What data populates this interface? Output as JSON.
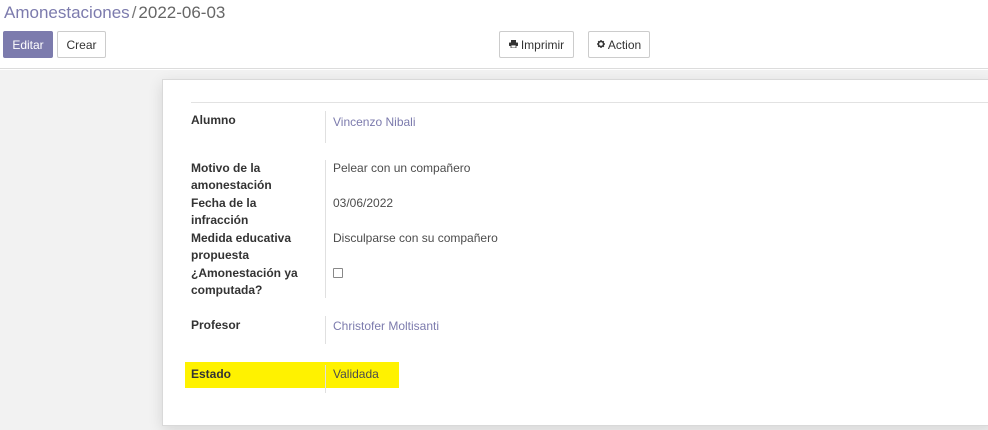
{
  "breadcrumb": {
    "parent": "Amonestaciones",
    "separator": "/",
    "current": "2022-06-03"
  },
  "toolbar": {
    "edit_label": "Editar",
    "create_label": "Crear",
    "print_label": "Imprimir",
    "print_icon": "print-icon",
    "action_label": "Action",
    "action_icon": "gear-icon"
  },
  "form": {
    "alumno_label": "Alumno",
    "alumno_value": "Vincenzo Nibali",
    "motivo_label_1": "Motivo de la",
    "motivo_label_2": "amonestación",
    "motivo_value": "Pelear con un compañero",
    "fecha_label_1": "Fecha de la",
    "fecha_label_2": "infracción",
    "fecha_value": "03/06/2022",
    "medida_label_1": "Medida educativa",
    "medida_label_2": "propuesta",
    "medida_value": "Disculparse con su compañero",
    "computada_label_1": "¿Amonestación ya",
    "computada_label_2": "computada?",
    "computada_checked": false,
    "profesor_label": "Profesor",
    "profesor_value": "Christofer Moltisanti",
    "estado_label": "Estado",
    "estado_value": "Validada"
  },
  "colors": {
    "brand": "#7c7bad",
    "highlight": "#fff200"
  }
}
